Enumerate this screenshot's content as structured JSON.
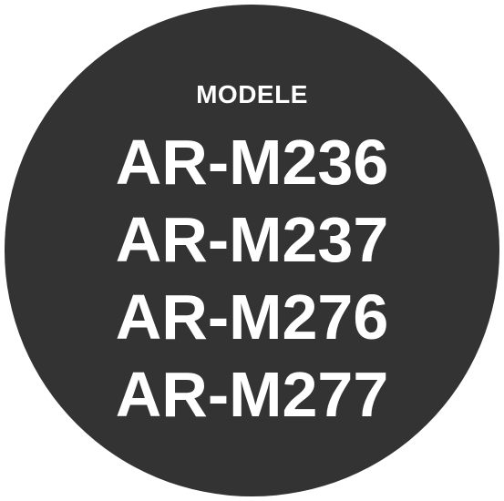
{
  "badge": {
    "heading": "MODELE",
    "models": [
      "AR-M236",
      "AR-M237",
      "AR-M276",
      "AR-M277"
    ],
    "colors": {
      "circle": "#333333",
      "text": "#ffffff",
      "background": "#ffffff"
    }
  }
}
